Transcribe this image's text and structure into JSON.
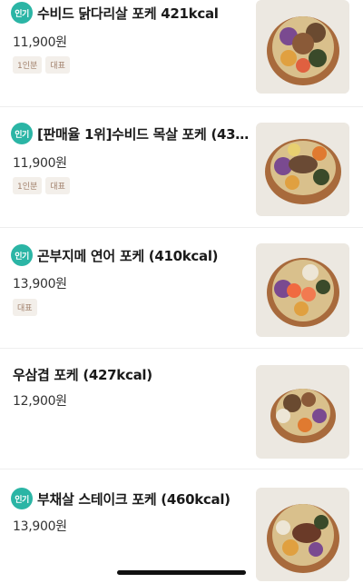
{
  "items": [
    {
      "popular": true,
      "popular_label": "인기",
      "name": "수비드 닭다리살 포케 421kcal",
      "price": "11,900원",
      "tags": [
        "1인분",
        "대표"
      ],
      "thumb_icon": "poke-bowl-chicken-image"
    },
    {
      "popular": true,
      "popular_label": "인기",
      "name": "[판매율 1위]수비드 목살 포케 (43…",
      "price": "11,900원",
      "tags": [
        "1인분",
        "대표"
      ],
      "thumb_icon": "poke-bowl-pork-image"
    },
    {
      "popular": true,
      "popular_label": "인기",
      "name": "곤부지메 연어 포케 (410kcal)",
      "price": "13,900원",
      "tags": [
        "대표"
      ],
      "thumb_icon": "poke-bowl-salmon-image"
    },
    {
      "popular": false,
      "name": "우삼겹 포케 (427kcal)",
      "price": "12,900원",
      "tags": [],
      "thumb_icon": "poke-bowl-beef-image"
    },
    {
      "popular": true,
      "popular_label": "인기",
      "name": "부채살 스테이크 포케 (460kcal)",
      "price": "13,900원",
      "tags": [],
      "thumb_icon": "poke-bowl-steak-image"
    }
  ],
  "colors": {
    "popular_badge": "#2bb5a5",
    "tag_bg": "#f3efea",
    "tag_text": "#a07f6a"
  }
}
